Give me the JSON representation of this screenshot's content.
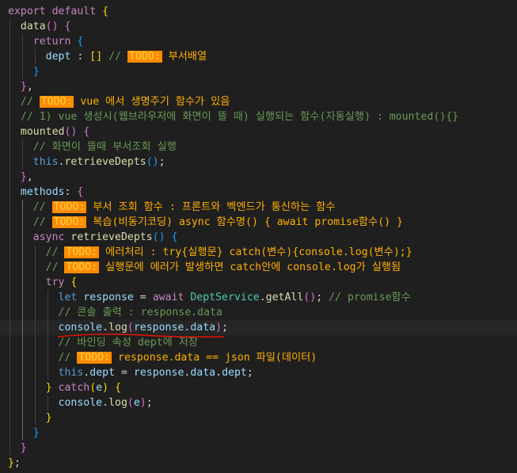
{
  "editor": {
    "language": "javascript",
    "lines": [
      "export default {",
      "  data() {",
      "    return {",
      "      dept : [] // TODO: 부서배열",
      "    }",
      "  },",
      "  // TODO: vue 에서 생명주기 함수가 있음",
      "  // 1) vue 생성시(웹브라우저에 화면이 뜰 때) 실행되는 함수(자동실행) : mounted(){}",
      "  mounted() {",
      "    // 화면이 뜰때 부서조회 실행",
      "    this.retrieveDepts();",
      "  },",
      "  methods: {",
      "    // TODO: 부서 조회 함수 : 프론트와 벡엔드가 통신하는 함수",
      "    // TODO: 복습(비동기코딩) async 함수명() { await promise함수() }",
      "    async retrieveDepts() {",
      "      // TODO: 에러처리 : try{실행문} catch(변수){console.log(변수);}",
      "      // TODO: 실행문에 에러가 발생하면 catch안에 console.log가 실행됨",
      "      try {",
      "        let response = await DeptService.getAll(); // promise함수",
      "        // 콘솔 출력 : response.data",
      "        console.log(response.data);",
      "        // 바인딩 속성 dept에 저장",
      "        // TODO: response.data == json 파일(데이터)",
      "        this.dept = response.data.dept;",
      "      } catch(e) {",
      "        console.log(e);",
      "      }",
      "    }",
      "  }",
      "};"
    ]
  }
}
